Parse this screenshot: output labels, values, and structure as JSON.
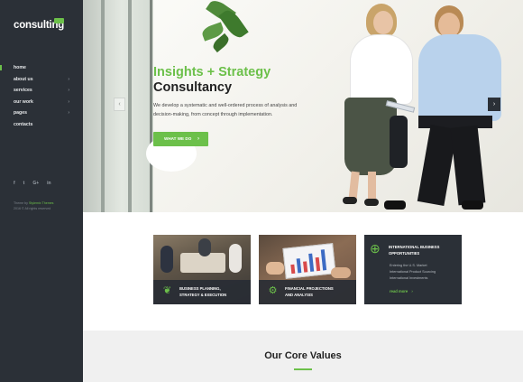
{
  "logo": "consulting",
  "nav": [
    {
      "label": "home",
      "active": true,
      "has_children": false
    },
    {
      "label": "about us",
      "active": false,
      "has_children": true
    },
    {
      "label": "services",
      "active": false,
      "has_children": true
    },
    {
      "label": "our work",
      "active": false,
      "has_children": true
    },
    {
      "label": "pages",
      "active": false,
      "has_children": true
    },
    {
      "label": "contacts",
      "active": false,
      "has_children": false
    }
  ],
  "social": {
    "facebook": "f",
    "twitter": "t",
    "googleplus": "G+",
    "linkedin": "in"
  },
  "credit": {
    "line1_prefix": "Theme by ",
    "line1_link": "Stylemix Themes",
    "line2": "2016 © All rights reserved"
  },
  "hero": {
    "title_line1": "Insights + Strategy",
    "title_line2": "Consultancy",
    "description": "We develop a systematic and well-ordered process of analysis and decision-making, from concept through implementation.",
    "button": "WHAT WE DO",
    "prev_arrow": "‹",
    "next_arrow": "›"
  },
  "cards": [
    {
      "title_line1": "BUSINESS PLANNING,",
      "title_line2": "STRATEGY & EXECUTION",
      "icon": "plant-hand-icon"
    },
    {
      "title_line1": "FINANCIAL PROJECTIONS",
      "title_line2": "AND ANALYSIS",
      "icon": "head-gear-icon"
    },
    {
      "title_line1": "INTERNATIONAL BUSINESS",
      "title_line2": "OPPORTUNITIES",
      "icon": "globe-person-icon",
      "items": [
        "Entering the U.S. Market",
        "International Product Sourcing",
        "International Investments"
      ],
      "more": "read more"
    }
  ],
  "core_values": {
    "title": "Our Core Values"
  },
  "colors": {
    "accent": "#6cc04a",
    "sidebar": "#2b3037"
  }
}
